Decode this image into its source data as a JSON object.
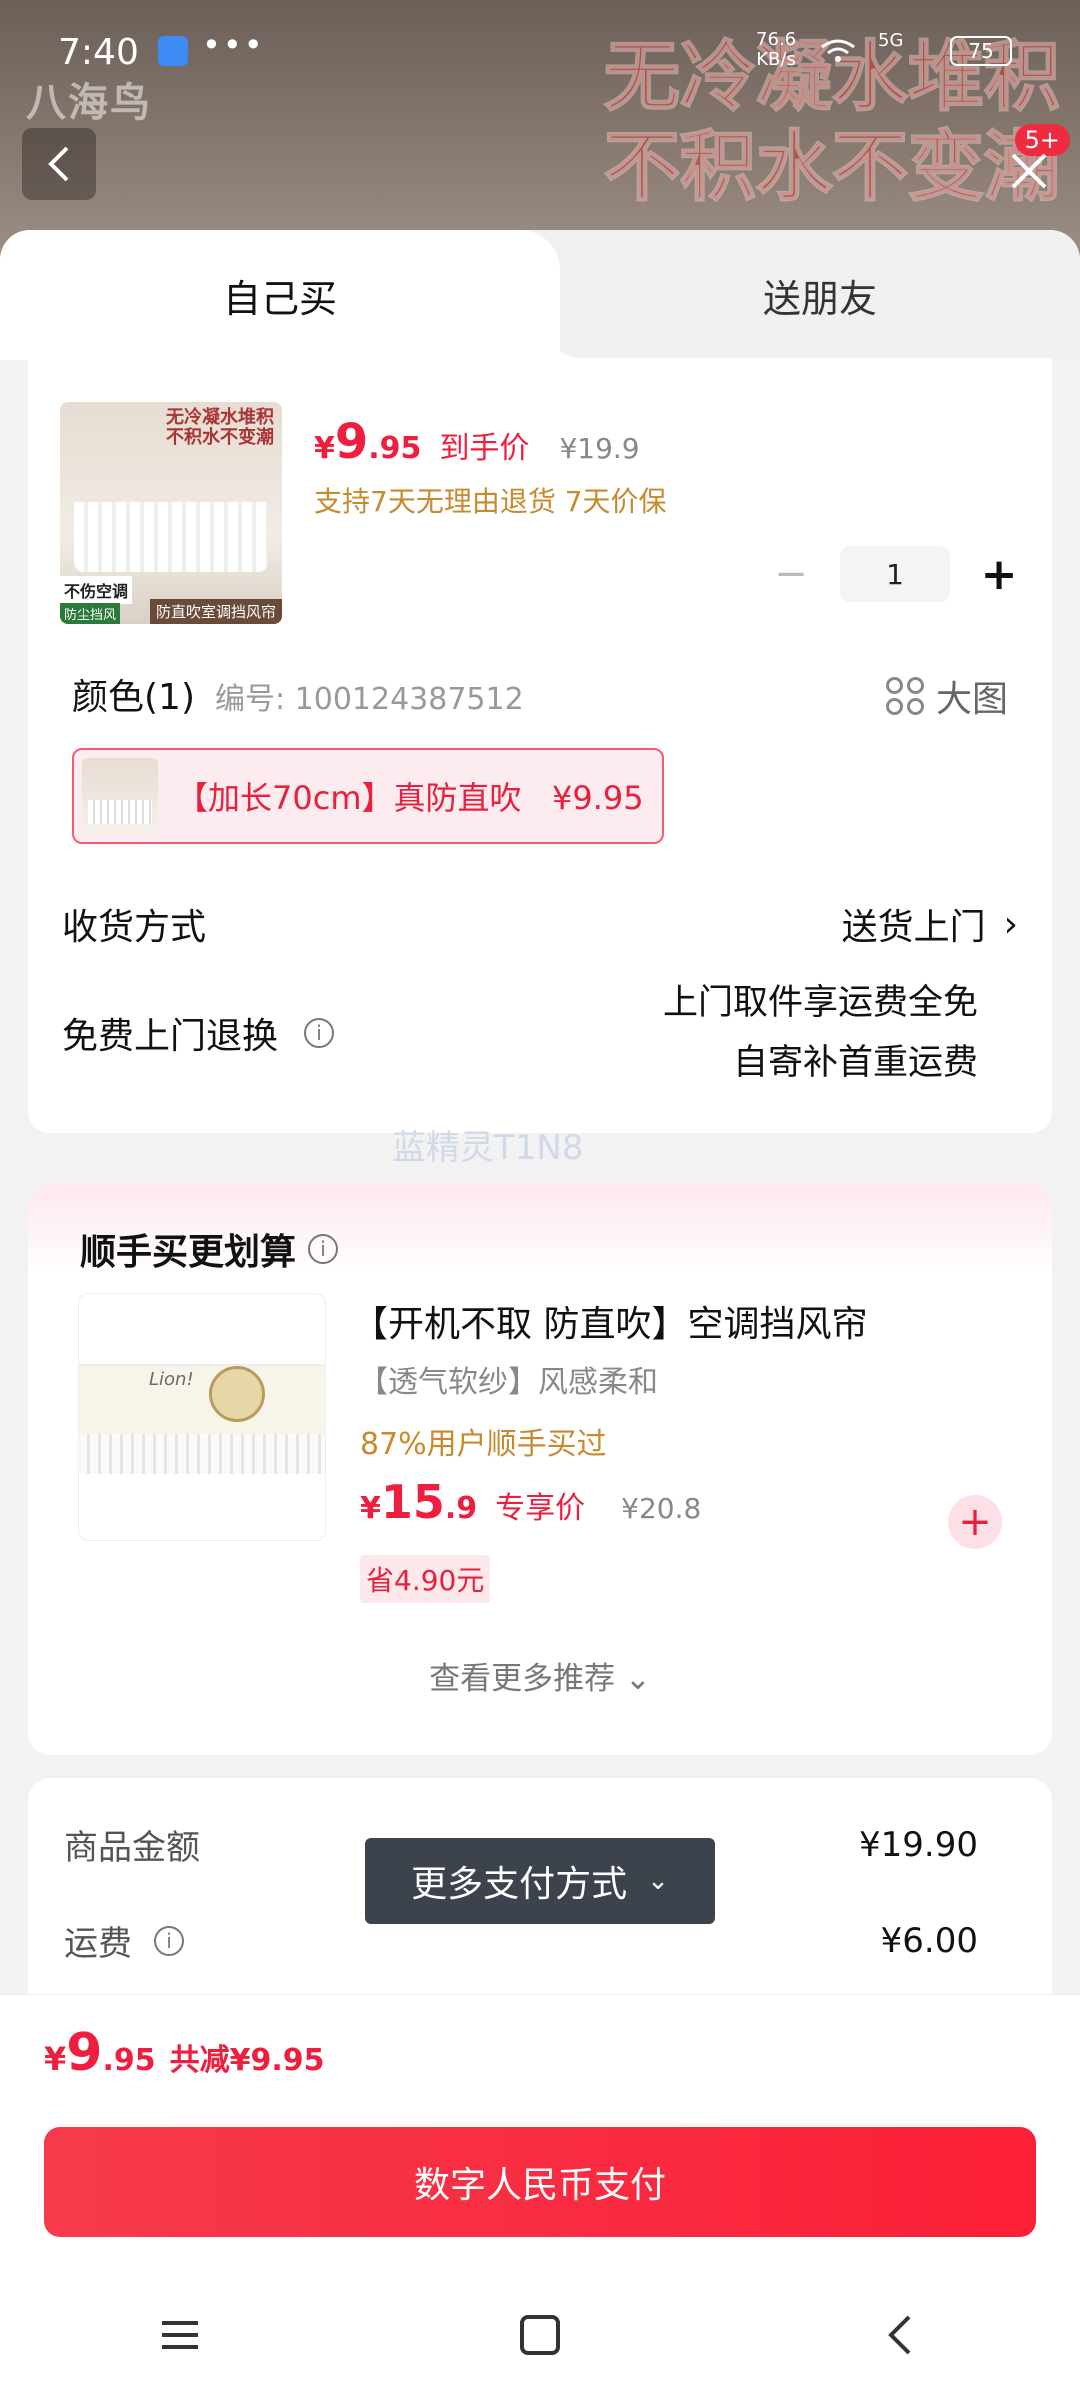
{
  "status_bar": {
    "time": "7:40",
    "dots": "•••",
    "speed": "76.6\nKB/s",
    "network": "5G",
    "battery": "75"
  },
  "banner": {
    "brand": "八海鸟",
    "slogan_line1": "无冷凝水堆积",
    "slogan_line2": "不积水不变潮",
    "badge": "5+"
  },
  "tabs": {
    "self": "自己买",
    "gift": "送朋友"
  },
  "product": {
    "thumb_top_text": "无冷凝水堆积\n不积水不变潮",
    "thumb_tag1": "不伤空调",
    "thumb_tag2": "防直吹室调挡风帘",
    "thumb_tag3": "防尘挡风",
    "price_currency": "¥",
    "price_int": "9",
    "price_dec": ".95",
    "price_label": "到手价",
    "orig_price": "¥19.9",
    "guarantee": "支持7天无理由退货  7天价保",
    "qty_minus": "−",
    "qty": "1",
    "qty_plus": "+"
  },
  "spec": {
    "title": "颜色(1)",
    "code": "编号: 100124387512",
    "big_image": "大图",
    "variant": "【加长70cm】真防直吹   ¥9.95"
  },
  "delivery": {
    "ship_label": "收货方式",
    "ship_value": "送货上门",
    "ship_chevron": "›",
    "return_label": "免费上门退换",
    "return_line1": "上门取件享运费全免",
    "return_line2": "自寄补首重运费",
    "info_icon": "i"
  },
  "watermark": "蓝精灵T1N8",
  "recommend": {
    "title": "顺手买更划算",
    "name": "【开机不取 防直吹】空调挡风帘",
    "sub": "【透气软纱】风感柔和",
    "bought": "87%用户顺手买过",
    "price_currency": "¥",
    "price_int": "15",
    "price_dec": ".9",
    "price_label": "专享价",
    "orig_price": "¥20.8",
    "save": "省4.90元",
    "add": "+",
    "more": "查看更多推荐 ⌄",
    "thumb_text": "Lion!"
  },
  "amount": {
    "goods_label": "商品金额",
    "goods_value": "¥19.90",
    "freight_label": "运费",
    "freight_value": "¥6.00"
  },
  "more_pay": {
    "label": "更多支付方式",
    "chevron": "⌄"
  },
  "bottom": {
    "total_currency": "¥",
    "total_int": "9",
    "total_dec": ".95",
    "total_cut": "共减¥9.95",
    "pay_button": "数字人民币支付"
  },
  "colors": {
    "accent_red": "#ee1f3e",
    "gold": "#c78a2c",
    "pay_gradient": "#f63a4c"
  }
}
